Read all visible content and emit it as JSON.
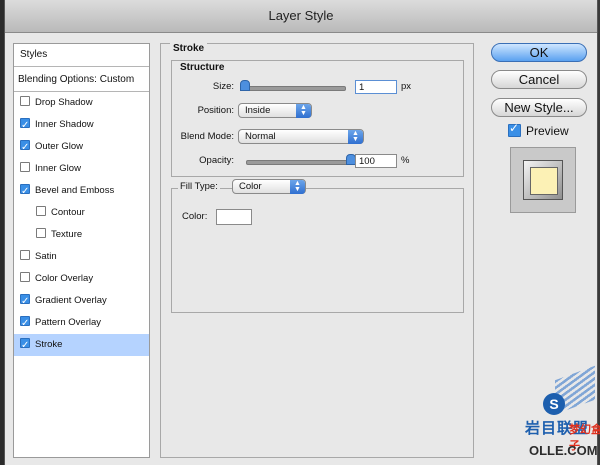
{
  "window": {
    "title": "Layer Style"
  },
  "styles_list": {
    "header": "Styles",
    "blending": "Blending Options: Custom",
    "items": [
      {
        "label": "Drop Shadow",
        "checked": false,
        "sub": false
      },
      {
        "label": "Inner Shadow",
        "checked": true,
        "sub": false
      },
      {
        "label": "Outer Glow",
        "checked": true,
        "sub": false
      },
      {
        "label": "Inner Glow",
        "checked": false,
        "sub": false
      },
      {
        "label": "Bevel and Emboss",
        "checked": true,
        "sub": false
      },
      {
        "label": "Contour",
        "checked": false,
        "sub": true
      },
      {
        "label": "Texture",
        "checked": false,
        "sub": true
      },
      {
        "label": "Satin",
        "checked": false,
        "sub": false
      },
      {
        "label": "Color Overlay",
        "checked": false,
        "sub": false
      },
      {
        "label": "Gradient Overlay",
        "checked": true,
        "sub": false
      },
      {
        "label": "Pattern Overlay",
        "checked": true,
        "sub": false
      },
      {
        "label": "Stroke",
        "checked": true,
        "sub": false,
        "selected": true
      }
    ]
  },
  "stroke": {
    "title": "Stroke",
    "structure_title": "Structure",
    "size_label": "Size:",
    "size_value": "1",
    "size_unit": "px",
    "size_fraction": 0.0,
    "position_label": "Position:",
    "position_value": "Inside",
    "blend_label": "Blend Mode:",
    "blend_value": "Normal",
    "opacity_label": "Opacity:",
    "opacity_value": "100",
    "opacity_unit": "%",
    "opacity_fraction": 1.0,
    "fill_type_label": "Fill Type:",
    "fill_type_value": "Color",
    "color_label": "Color:",
    "color_value": "#ffffff"
  },
  "buttons": {
    "ok": "OK",
    "cancel": "Cancel",
    "new_style": "New Style...",
    "preview_label": "Preview",
    "preview_checked": true
  },
  "watermark": {
    "mark": "S",
    "cn1": "岩目联盟",
    "cn2": "梦幻盒子",
    "url": "OLLE.COM"
  },
  "colors": {
    "selected_row": "#b5d3ff",
    "checkbox_on": "#3a8fe6",
    "primary_button": "#5aa1f0",
    "preview_fill": "#fcf1b5"
  }
}
